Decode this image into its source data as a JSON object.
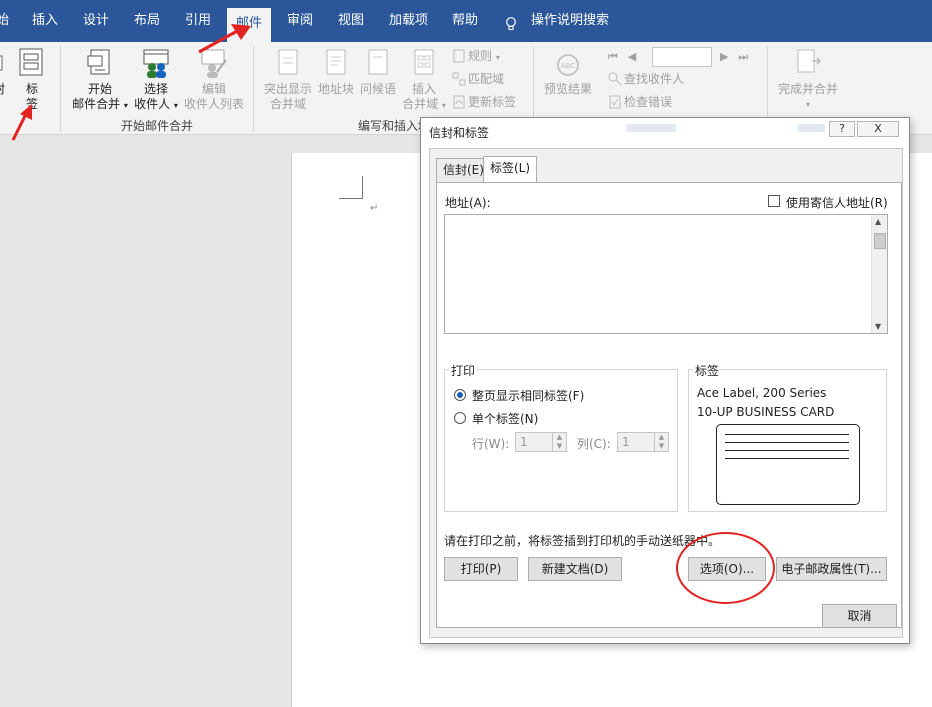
{
  "menu": {
    "items": [
      "始",
      "插入",
      "设计",
      "布局",
      "引用",
      "邮件",
      "审阅",
      "视图",
      "加载项",
      "帮助"
    ],
    "active": "邮件",
    "tell_me": "操作说明搜索"
  },
  "ribbon": {
    "labels_btn": [
      "标",
      "签"
    ],
    "partial_left": "封",
    "start_merge": [
      "开始",
      "邮件合并"
    ],
    "select_recipients": [
      "选择",
      "收件人"
    ],
    "edit_list": [
      "编辑",
      "收件人列表"
    ],
    "group_start": "开始邮件合并",
    "highlight_fields": [
      "突出显示",
      "合并域"
    ],
    "address_block": "地址块",
    "greeting_line": "问候语",
    "insert_field": [
      "插入",
      "合并域"
    ],
    "rules": "规则",
    "match_fields": "匹配域",
    "update_labels": "更新标签",
    "group_write": "编写和插入域",
    "preview_results": "预览结果",
    "find_recipient": "查找收件人",
    "check_errors": "检查错误",
    "finish_merge": [
      "完成并合并"
    ]
  },
  "dialog": {
    "title": "信封和标签",
    "help_btn": "?",
    "close_btn": "X",
    "tabs": [
      "信封(E)",
      "标签(L)"
    ],
    "address_label": "地址(A):",
    "use_return_address": "使用寄信人地址(R)",
    "address_value": "",
    "print_group": "打印",
    "full_page": "整页显示相同标签(F)",
    "single_label": "单个标签(N)",
    "row_label": "行(W):",
    "row_value": "1",
    "col_label": "列(C):",
    "col_value": "1",
    "label_group": "标签",
    "label_line1": "Ace Label, 200 Series",
    "label_line2": "10-UP BUSINESS CARD",
    "hint": "请在打印之前，将标签插到打印机的手动送纸器中。",
    "print_btn": "打印(P)",
    "new_doc_btn": "新建文档(D)",
    "options_btn": "选项(O)...",
    "epostage_btn": "电子邮政属性(T)...",
    "cancel_btn": "取消"
  },
  "colors": {
    "menubar": "#2b579a",
    "annotation_red": "#e32222"
  }
}
